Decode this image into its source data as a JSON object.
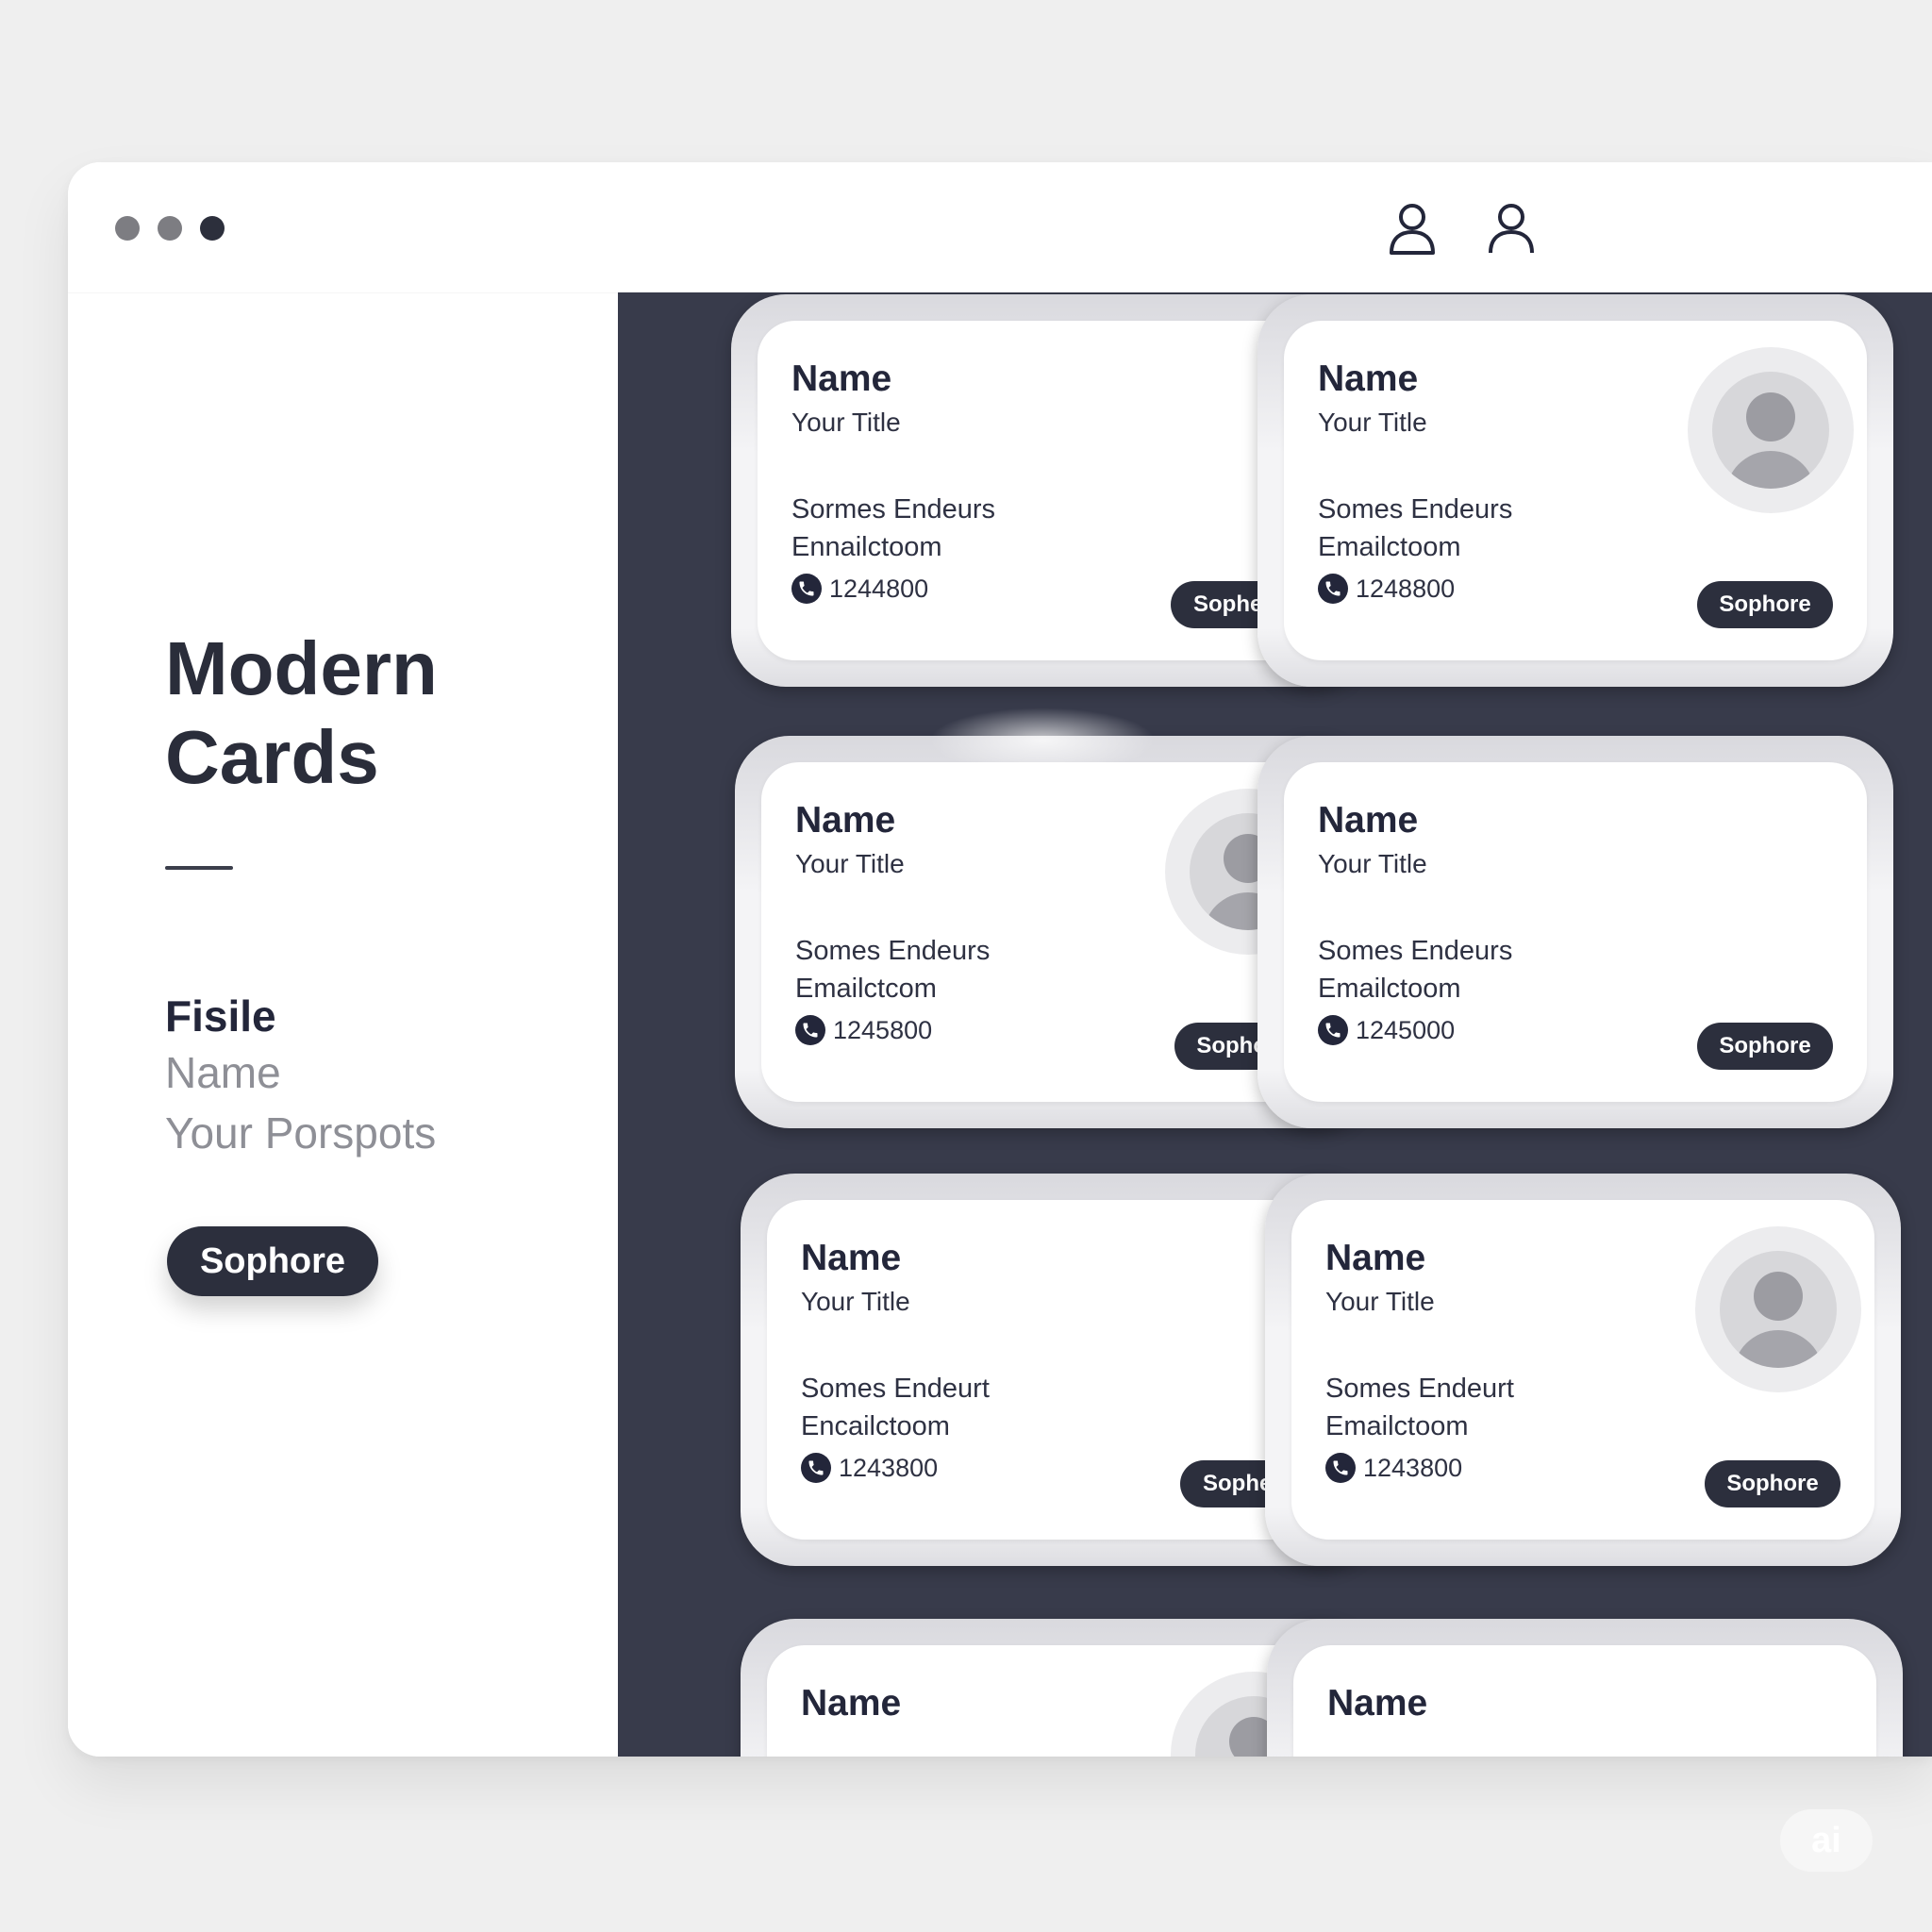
{
  "window": {
    "dots": [
      "window-dot-1",
      "window-dot-2",
      "window-dot-3"
    ],
    "icons": [
      "user-icon",
      "user-icon"
    ]
  },
  "sidebar": {
    "title_line1": "Modern",
    "title_line2": "Cards",
    "heading": "Fisile",
    "line1": "Name",
    "line2": "Your Porspots",
    "button_label": "Sophore"
  },
  "cards": [
    {
      "name": "Name",
      "title": "Your Title",
      "address": "Sormes Endeurs",
      "email": "Ennailctoom",
      "phone": "1244800",
      "button": "Sophere",
      "avatar": false
    },
    {
      "name": "Name",
      "title": "Your Title",
      "address": "Somes Endeurs",
      "email": "Emailctoom",
      "phone": "1248800",
      "button": "Sophore",
      "avatar": true
    },
    {
      "name": "Name",
      "title": "Your Title",
      "address": "Somes Endeurs",
      "email": "Emailctcom",
      "phone": "1245800",
      "button": "Sophore",
      "avatar": true
    },
    {
      "name": "Name",
      "title": "Your Title",
      "address": "Somes Endeurs",
      "email": "Emailctoom",
      "phone": "1245000",
      "button": "Sophore",
      "avatar": false
    },
    {
      "name": "Name",
      "title": "Your Title",
      "address": "Somes Endeurt",
      "email": "Encailctoom",
      "phone": "1243800",
      "button": "Sophere",
      "avatar": false
    },
    {
      "name": "Name",
      "title": "Your Title",
      "address": "Somes Endeurt",
      "email": "Emailctoom",
      "phone": "1243800",
      "button": "Sophore",
      "avatar": true
    },
    {
      "name": "Name",
      "title": "",
      "address": "",
      "email": "",
      "phone": "",
      "button": "",
      "avatar": true
    },
    {
      "name": "Name",
      "title": "",
      "address": "",
      "email": "",
      "phone": "",
      "button": "",
      "avatar": false
    }
  ],
  "badge": "ai",
  "colors": {
    "dark": "#2c2f3d",
    "panel": "#383b4b",
    "background": "#efefef"
  }
}
